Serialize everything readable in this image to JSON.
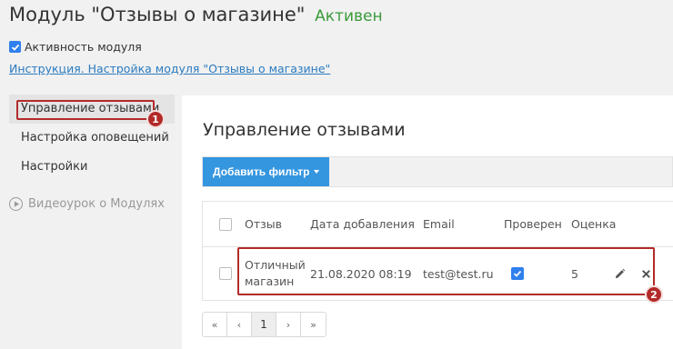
{
  "page": {
    "title": "Модуль \"Отзывы о магазине\"",
    "status": "Активен",
    "activity_label": "Активность модуля",
    "instruction_link": "Инструкция. Настройка модуля \"Отзывы о магазине\""
  },
  "sidebar": {
    "items": [
      {
        "label": "Управление отзывами"
      },
      {
        "label": "Настройка оповещений"
      },
      {
        "label": "Настройки"
      }
    ],
    "video_label": "Видеоурок о Модулях"
  },
  "main": {
    "heading": "Управление отзывами",
    "add_filter_label": "Добавить фильтр"
  },
  "table": {
    "columns": [
      "Отзыв",
      "Дата добавления",
      "Email",
      "Проверен",
      "Оценка"
    ],
    "rows": [
      {
        "review": "Отличный магазин",
        "date": "21.08.2020 08:19",
        "email": "test@test.ru",
        "verified": true,
        "rating": "5"
      }
    ]
  },
  "pagination": {
    "first": "«",
    "prev": "‹",
    "current": "1",
    "next": "›",
    "last": "»"
  },
  "markers": {
    "one": "1",
    "two": "2"
  },
  "colors": {
    "accent": "#3596e0",
    "status_green": "#3a9a3a",
    "annotation_red": "#b32a2a",
    "link": "#2a7bc0"
  }
}
